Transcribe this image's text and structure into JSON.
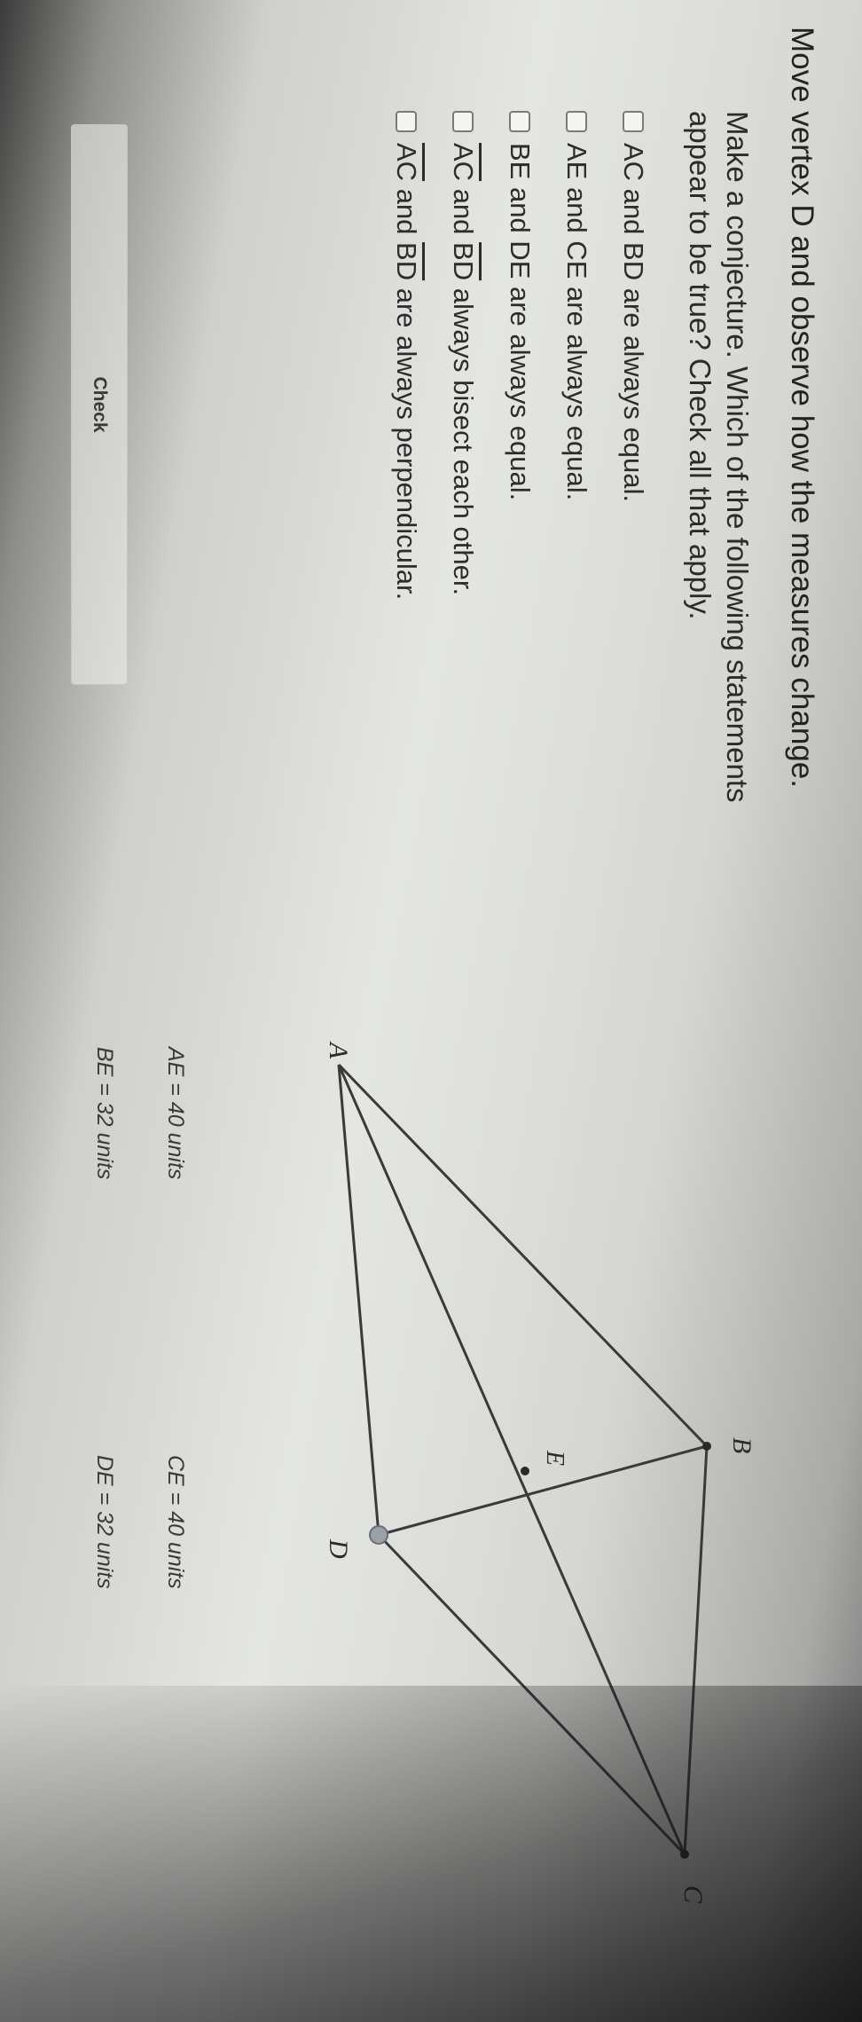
{
  "instruction": "Move vertex D and observe how the measures change.",
  "prompt": "Make a conjecture. Which of the following statements appear to be true? Check all that apply.",
  "options": [
    {
      "label": "AC and BD are always equal.",
      "checked": false
    },
    {
      "label": "AE and CE are always equal.",
      "checked": false
    },
    {
      "label": "BE and DE are always equal.",
      "checked": false
    },
    {
      "seg1": "AC",
      "mid": " and ",
      "seg2": "BD",
      "tail": " always bisect each other.",
      "checked": false
    },
    {
      "seg1": "AC",
      "mid": " and ",
      "seg2": "BD",
      "tail": " are always perpendicular.",
      "checked": false
    }
  ],
  "check_label": "Check",
  "diagram": {
    "vertices": {
      "A": "A",
      "B": "B",
      "C": "C",
      "D": "D",
      "E": "E"
    },
    "measures": {
      "ae": "AE = 40 units",
      "ce": "CE = 40 units",
      "be": "BE = 32 units",
      "de": "DE = 32 units"
    }
  },
  "colors": {
    "line": "#3a3a3a",
    "text": "#2b2b2b",
    "background": "#e2e4e0"
  }
}
